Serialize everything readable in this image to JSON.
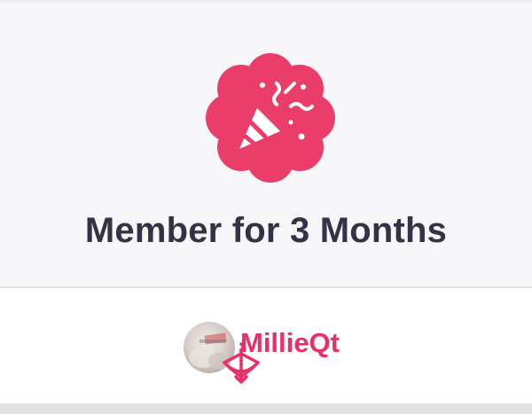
{
  "achievement": {
    "icon": "party-popper-icon",
    "badge_color": "#ea3d6a",
    "title": "Member for 3 Months"
  },
  "member": {
    "username": "MillieQt",
    "avatar": "avatar-photo",
    "tag_icon": "bow-arrow-icon",
    "accent_color": "#ea2f68"
  }
}
